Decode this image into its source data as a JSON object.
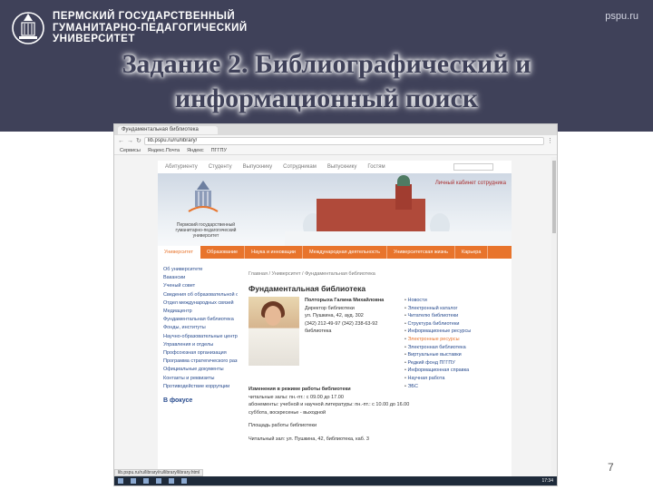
{
  "slide": {
    "university": [
      "ПЕРМСКИЙ ГОСУДАРСТВЕННЫЙ",
      "ГУМАНИТАРНО-ПЕДАГОГИЧЕСКИЙ",
      "УНИВЕРСИТЕТ"
    ],
    "site": "pspu.ru",
    "title_line1": "Задание 2. Библиографический и",
    "title_line2": "информационный поиск",
    "page_number": "7"
  },
  "browser": {
    "tab_label": "Фундаментальная библиотека",
    "address": "lib.pspu.ru/ru/library/",
    "bookmarks": [
      "Сервисы",
      "Яндекс.Почта",
      "Яндекс",
      "ПГГПУ"
    ]
  },
  "site_page": {
    "top_menu": [
      "Абитуриенту",
      "Студенту",
      "Выпускнику",
      "Сотрудникам",
      "Выпускнику",
      "Гостям"
    ],
    "hero_tagline": "Личный кабинет сотрудника",
    "seal_caption": "Пермский государственный гуманитарно-педагогический университет",
    "main_menu": [
      "Университет",
      "Образование",
      "Наука и инновации",
      "Международная деятельность",
      "Университетская жизнь",
      "Карьера"
    ],
    "left_nav": [
      "Об университете",
      "Вакансии",
      "Ученый совет",
      "Сведения об образовательной организации",
      "Отдел международных связей",
      "Медиацентр",
      "Фундаментальная библиотека",
      "Фонды, институты",
      "Научно-образовательные центры",
      "Управления и отделы",
      "Профсоюзная организация",
      "Программа стратегического развития",
      "Официальные документы",
      "Контакты и реквизиты",
      "Противодействие коррупции"
    ],
    "left_nav_heading": "В фокусе",
    "breadcrumb": "Главная / Университет / Фундаментальная библиотека",
    "page_title": "Фундаментальная библиотека",
    "director": [
      "Полторыха Галина Михайловна",
      "Директор библиотеки",
      "ул. Пушкина, 42, ауд. 302",
      "(342) 212-49-97 (342) 238-63-92",
      "библиотека"
    ],
    "right_list": [
      "Новости",
      "Электронный каталог",
      "Читателю библиотеки",
      "Структура библиотеки",
      "Информационные ресурсы",
      "Электронные ресурсы",
      "Электронная библиотека",
      "Виртуальные выставки",
      "Редкий фонд ПГГПУ",
      "Информационная справка",
      "Научная работа",
      "ЭБС"
    ],
    "changes": [
      "Изменения в режиме работы библиотеки",
      "читальные залы: пн.-пт.: с 09.00 до 17.00",
      "абонементы: учебной и научной литературы: пн.-пт.: с 10.00 до 16.00",
      "суббота, воскресенье - выходной",
      "Площадь работы библиотеки",
      "Читальный зал: ул. Пушкина, 42, библиотека, каб. 3"
    ],
    "status_url": "lib.pspu.ru/ru/library/ru/library/library.html",
    "clock": "17:34"
  },
  "colors": {
    "header": "#3f4159",
    "orange": "#e8742c"
  }
}
